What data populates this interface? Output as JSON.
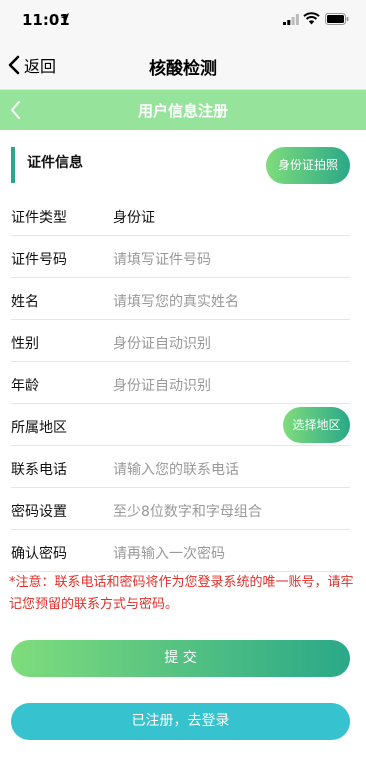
{
  "status_bar": {
    "time": "11:01",
    "icons": [
      "location-arrow-icon",
      "cellular-signal-icon",
      "wifi-icon",
      "battery-icon"
    ]
  },
  "nav": {
    "back_label": "返回",
    "title": "核酸检测"
  },
  "header": {
    "title": "用户信息注册",
    "back_icon": "chevron-left-icon",
    "background": "#96e39b"
  },
  "section": {
    "title": "证件信息",
    "id_photo_button": "身份证拍照"
  },
  "form": {
    "id_type": {
      "label": "证件类型",
      "value": "身份证"
    },
    "id_number": {
      "label": "证件号码",
      "placeholder": "请填写证件号码"
    },
    "name": {
      "label": "姓名",
      "placeholder": "请填写您的真实姓名"
    },
    "gender": {
      "label": "性别",
      "placeholder": "身份证自动识别"
    },
    "age": {
      "label": "年龄",
      "placeholder": "身份证自动识别"
    },
    "region": {
      "label": "所属地区",
      "button": "选择地区"
    },
    "phone": {
      "label": "联系电话",
      "placeholder": "请输入您的联系电话"
    },
    "password": {
      "label": "密码设置",
      "placeholder": "至少8位数字和字母组合"
    },
    "confirm_password": {
      "label": "确认密码",
      "placeholder": "请再输入一次密码"
    }
  },
  "notice": "*注意：联系电话和密码将作为您登录系统的唯一账号，请牢记您预留的联系方式与密码。",
  "buttons": {
    "submit": "提 交",
    "login": "已注册，去登录"
  },
  "colors": {
    "accent_green": "#2aa888",
    "light_green": "#7fdc7c",
    "login_cyan": "#37c2cf",
    "notice_red": "#e0302a"
  }
}
